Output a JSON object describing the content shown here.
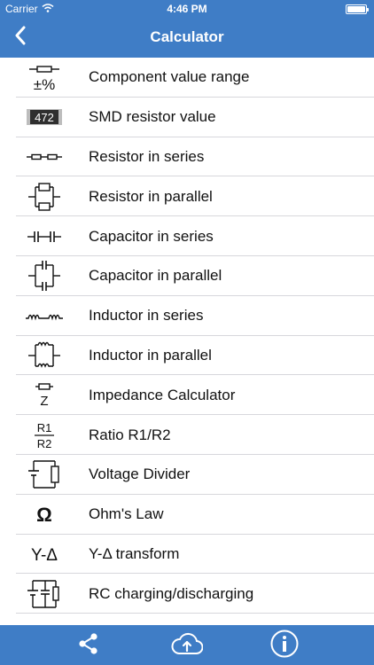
{
  "status_bar": {
    "carrier": "Carrier",
    "time": "4:46 PM"
  },
  "nav": {
    "title": "Calculator"
  },
  "list": {
    "items": [
      {
        "label": "Component value range",
        "icon": "component-range-icon",
        "icon_text": "±%"
      },
      {
        "label": "SMD resistor value",
        "icon": "smd-resistor-icon",
        "icon_text": "472"
      },
      {
        "label": "Resistor in series",
        "icon": "resistor-series-icon"
      },
      {
        "label": "Resistor in parallel",
        "icon": "resistor-parallel-icon"
      },
      {
        "label": "Capacitor in series",
        "icon": "capacitor-series-icon"
      },
      {
        "label": "Capacitor in parallel",
        "icon": "capacitor-parallel-icon"
      },
      {
        "label": "Inductor in series",
        "icon": "inductor-series-icon"
      },
      {
        "label": "Inductor in parallel",
        "icon": "inductor-parallel-icon"
      },
      {
        "label": "Impedance Calculator",
        "icon": "impedance-icon",
        "icon_text": "Z"
      },
      {
        "label": "Ratio R1/R2",
        "icon": "ratio-icon",
        "icon_text_top": "R1",
        "icon_text_bottom": "R2"
      },
      {
        "label": "Voltage Divider",
        "icon": "voltage-divider-icon"
      },
      {
        "label": "Ohm's Law",
        "icon": "ohm-icon",
        "icon_text": "Ω"
      },
      {
        "label": "Y-Δ transform",
        "icon": "y-delta-icon",
        "icon_text": "Y-Δ"
      },
      {
        "label": "RC charging/discharging",
        "icon": "rc-charging-icon"
      }
    ]
  },
  "toolbar": {
    "share_icon": "share-icon",
    "upload_icon": "cloud-upload-icon",
    "info_icon": "info-icon"
  },
  "colors": {
    "accent": "#3f7dc6",
    "separator": "#d7d7dc",
    "text": "#111111",
    "white": "#ffffff"
  }
}
